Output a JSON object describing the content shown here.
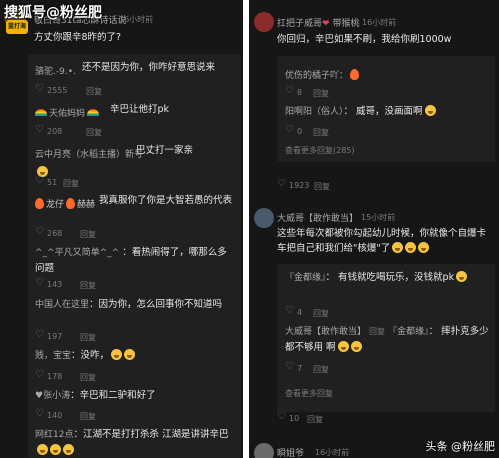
{
  "watermark": {
    "text": "搜狐号@粉丝肥",
    "logo": "蓝打海",
    "bottom": "头条 @粉丝肥"
  },
  "left": {
    "header": {
      "name": "敬白哥31ta芯酥诗话说",
      "time": "16小时前",
      "text": "方丈你跟辛8昨的了?"
    },
    "comments": [
      {
        "name": "骆驼.-9.•.",
        "text": "还不是因为你，你咋好意思说来",
        "likes": "2555",
        "reply": "回复"
      },
      {
        "name": "天佑妈妈",
        "text": "辛巴让他打pk",
        "likes": "208",
        "reply": "回复"
      },
      {
        "name": "云中月亮（水稻主播）新号",
        "text": "巴丈打一家亲",
        "likes": "",
        "reply": ""
      },
      {
        "name": "",
        "text": "",
        "likes": "51",
        "reply": "回复"
      },
      {
        "name": "龙仔",
        "name2": "赫赫",
        "text": "我真服你了你是大智若愚的代表",
        "likes": "268",
        "reply": "回复"
      },
      {
        "name": "^_^平凡又简单^_^",
        "text": "看热闹得了，哪那么多问题",
        "likes": "143",
        "reply": "回复"
      },
      {
        "name": "中国人在这里",
        "text": "因为你，怎么回事你不知道吗",
        "likes": "197",
        "reply": "回复"
      },
      {
        "name": "贱，宝宝",
        "text": "没咋，",
        "likes": "178",
        "reply": "回复"
      },
      {
        "name": "张小涛",
        "text": "辛巴和二驴和好了",
        "likes": "140",
        "reply": "回复"
      },
      {
        "name": "网红12点",
        "text": "江湖不是打打杀杀 江湖是讲讲辛巴",
        "likes": "",
        "reply": ""
      }
    ]
  },
  "right": {
    "c1": {
      "name": "扛把子威哥",
      "name2": "带猴桃",
      "time": "16小时前",
      "text": "你回归，辛巴如果不刷，我给你刷1000w",
      "sub": {
        "name": "优伤的橘子吖",
        "likes": "8",
        "reply": "回复",
        "name2": "阳啊阳（俗人）",
        "text2": "威哥，没画面啊",
        "likes2": "0",
        "reply2": "回复",
        "more": "查看更多回复(285)"
      },
      "likes": "1923",
      "reply": "回复"
    },
    "c2": {
      "name": "大威哥【敢作敢当】",
      "time": "15小时前",
      "text": "这些年每次都被你勾起幼儿时候，你就像个自爆卡车把自己和我们给\"核爆\"了",
      "sub": {
        "name": "『金都缘』",
        "text": "有钱就吃喝玩乐，没钱就pk",
        "likes": "4",
        "reply": "回复",
        "name2": "大威哥【敢作敢当】",
        "reply_label": "回复",
        "to": "『金都缘』",
        "text2": "摔扑克多少都不够用 啊",
        "likes2": "7",
        "reply2": "回复",
        "more": "查看更多回复"
      },
      "likes": "10",
      "reply": "回复"
    },
    "c3": {
      "name": "瞬姐爷",
      "time": "16小时前"
    }
  },
  "colors": {
    "background": "#161616",
    "subpanel": "#202020",
    "text": "#e8e8e8",
    "muted": "#7a7a7a"
  }
}
